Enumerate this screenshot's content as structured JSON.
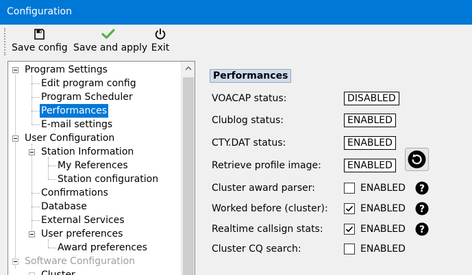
{
  "window": {
    "title": "Configuration"
  },
  "toolbar": {
    "save_config": "Save config",
    "save_apply": "Save and apply",
    "exit": "Exit"
  },
  "tree": {
    "program_settings": "Program Settings",
    "edit_program_config": "Edit program config",
    "program_scheduler": "Program Scheduler",
    "performances": "Performances",
    "email_settings": "E-mail settings",
    "user_configuration": "User Configuration",
    "station_information": "Station Information",
    "my_references": "My References",
    "station_configuration": "Station configuration",
    "confirmations": "Confirmations",
    "database": "Database",
    "external_services": "External Services",
    "user_preferences": "User preferences",
    "award_preferences": "Award preferences",
    "software_configuration": "Software Configuration",
    "cluster": "Cluster"
  },
  "panel": {
    "section_title": "Performances",
    "voacap_label": "VOACAP status:",
    "voacap_value": "DISABLED",
    "clublog_label": "Clublog status:",
    "clublog_value": "ENABLED",
    "ctydat_label": "CTY.DAT status:",
    "ctydat_value": "ENABLED",
    "profile_label": "Retrieve profile image:",
    "profile_value": "ENABLED",
    "award_parser_label": "Cluster award parser:",
    "award_parser_checked": false,
    "award_parser_text": "ENABLED",
    "worked_before_label": "Worked before (cluster):",
    "worked_before_checked": true,
    "worked_before_text": "ENABLED",
    "realtime_label": "Realtime callsign stats:",
    "realtime_checked": true,
    "realtime_text": "ENABLED",
    "cq_search_label": "Cluster CQ search:",
    "cq_search_checked": false,
    "cq_search_text": "ENABLED"
  },
  "icons": {
    "save": "floppy-disk-icon",
    "apply": "green-check-icon",
    "exit": "power-icon",
    "help": "question-circle-icon",
    "refresh": "refresh-icon"
  },
  "colors": {
    "titlebar": "#0078d7",
    "selection": "#0078d7",
    "section_header_bg": "#cfdcef",
    "apply_green": "#52b043"
  }
}
